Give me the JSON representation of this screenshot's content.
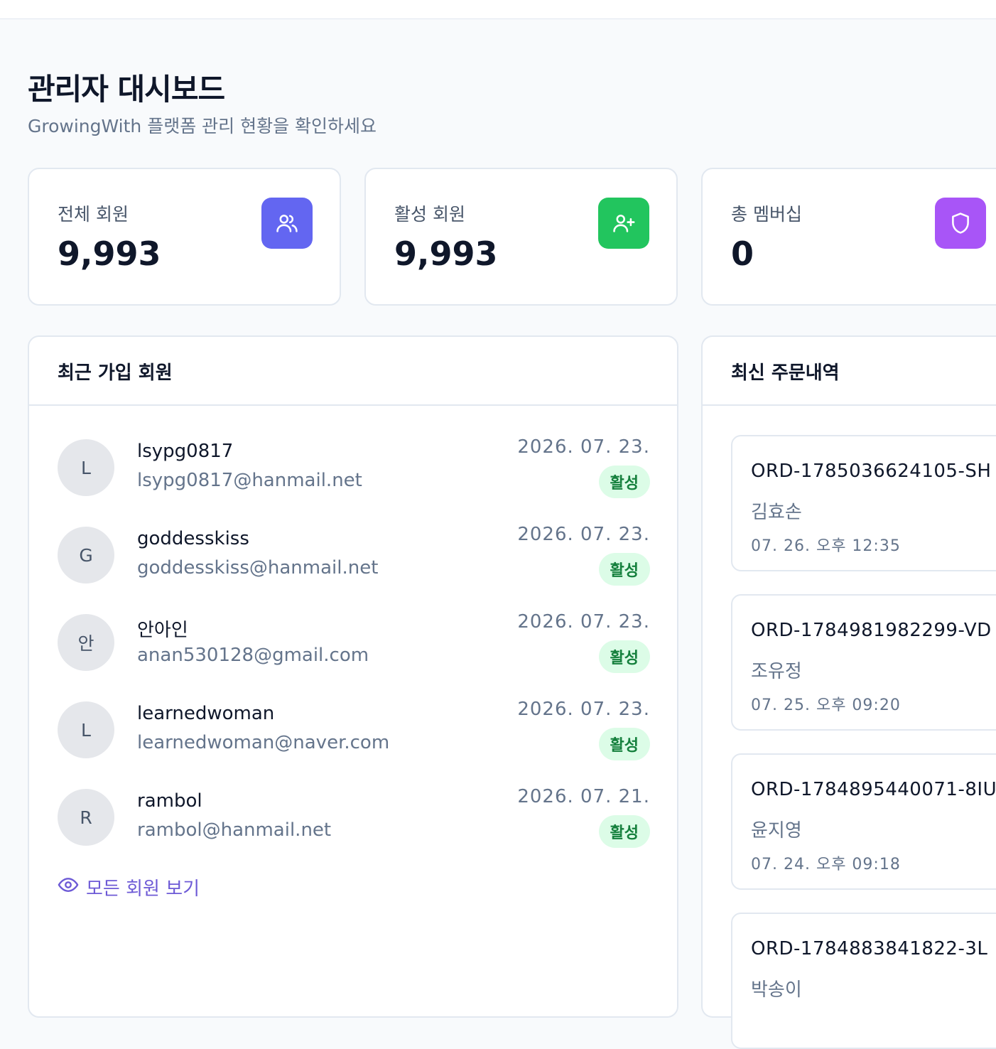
{
  "header": {
    "title": "관리자 대시보드",
    "subtitle": "GrowingWith 플랫폼 관리 현황을 확인하세요"
  },
  "stats": [
    {
      "label": "전체 회원",
      "value": "9,993",
      "icon": "users-icon",
      "color": "#6366f1"
    },
    {
      "label": "활성 회원",
      "value": "9,993",
      "icon": "user-plus-icon",
      "color": "#22c55e"
    },
    {
      "label": "총 멤버십",
      "value": "0",
      "icon": "shield-icon",
      "color": "#a855f7"
    }
  ],
  "recent_members": {
    "title": "최근 가입 회원",
    "items": [
      {
        "initial": "L",
        "name": "lsypg0817",
        "email": "lsypg0817@hanmail.net",
        "date": "2026. 07. 23.",
        "status": "활성"
      },
      {
        "initial": "G",
        "name": "goddesskiss",
        "email": "goddesskiss@hanmail.net",
        "date": "2026. 07. 23.",
        "status": "활성"
      },
      {
        "initial": "안",
        "name": "안아인",
        "email": "anan530128@gmail.com",
        "date": "2026. 07. 23.",
        "status": "활성"
      },
      {
        "initial": "L",
        "name": "learnedwoman",
        "email": "learnedwoman@naver.com",
        "date": "2026. 07. 23.",
        "status": "활성"
      },
      {
        "initial": "R",
        "name": "rambol",
        "email": "rambol@hanmail.net",
        "date": "2026. 07. 21.",
        "status": "활성"
      }
    ],
    "view_all_label": "모든 회원 보기"
  },
  "recent_orders": {
    "title": "최신 주문내역",
    "items": [
      {
        "id": "ORD-1785036624105-SH",
        "name": "김효손",
        "time": "07. 26. 오후 12:35"
      },
      {
        "id": "ORD-1784981982299-VD",
        "name": "조유정",
        "time": "07. 25. 오후 09:20"
      },
      {
        "id": "ORD-1784895440071-8IU",
        "name": "윤지영",
        "time": "07. 24. 오후 09:18"
      },
      {
        "id": "ORD-1784883841822-3L",
        "name": "박송이",
        "time": ""
      }
    ]
  }
}
